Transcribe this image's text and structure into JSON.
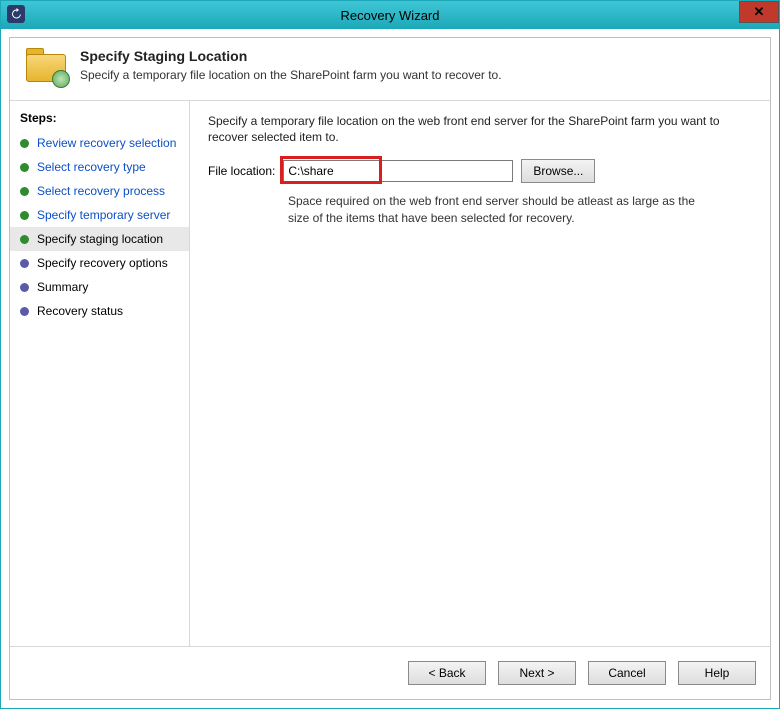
{
  "window": {
    "title": "Recovery Wizard"
  },
  "header": {
    "title": "Specify Staging Location",
    "subtitle": "Specify a temporary file location on the SharePoint farm you want to recover to."
  },
  "sidebar": {
    "label": "Steps:",
    "items": [
      {
        "label": "Review recovery selection",
        "state": "completed"
      },
      {
        "label": "Select recovery type",
        "state": "completed"
      },
      {
        "label": "Select recovery process",
        "state": "completed"
      },
      {
        "label": "Specify temporary server",
        "state": "completed"
      },
      {
        "label": "Specify staging location",
        "state": "current"
      },
      {
        "label": "Specify recovery options",
        "state": "future"
      },
      {
        "label": "Summary",
        "state": "future"
      },
      {
        "label": "Recovery status",
        "state": "future"
      }
    ]
  },
  "content": {
    "instruction": "Specify a temporary file location on the web front end server for the SharePoint farm you want to recover selected item to.",
    "file_label": "File location:",
    "file_value": "C:\\share",
    "browse_label": "Browse...",
    "hint": "Space required on the web front end server should be atleast as large as the size of the items that have been selected for recovery."
  },
  "footer": {
    "back": "< Back",
    "next": "Next >",
    "cancel": "Cancel",
    "help": "Help"
  }
}
